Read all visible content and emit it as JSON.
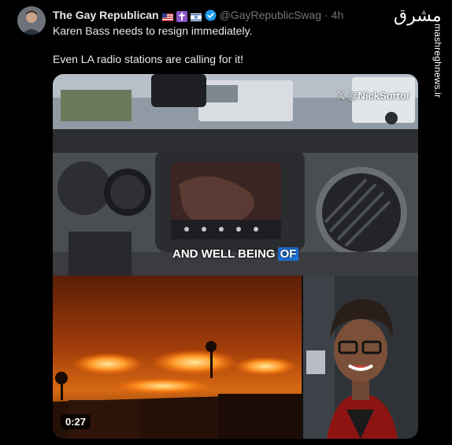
{
  "tweet": {
    "display_name": "The Gay Republican",
    "handle": "@GayRepublicSwag",
    "separator": "·",
    "time": "4h",
    "lines": [
      "Karen Bass needs to resign immediately.",
      "Even LA radio stations are calling for it!"
    ],
    "emoji_flags": [
      "us-flag-icon",
      "cross-icon",
      "israel-flag-icon"
    ]
  },
  "media": {
    "source_tag": "@NickSortor",
    "caption_words": [
      "AND WELL BEING",
      "OF"
    ],
    "duration": "0:27"
  },
  "watermark": {
    "logo": "مشرق",
    "site": "mashreghnews.ir"
  },
  "colors": {
    "verified": "#1d9bf0",
    "caption_highlight": "#1d72d8"
  }
}
